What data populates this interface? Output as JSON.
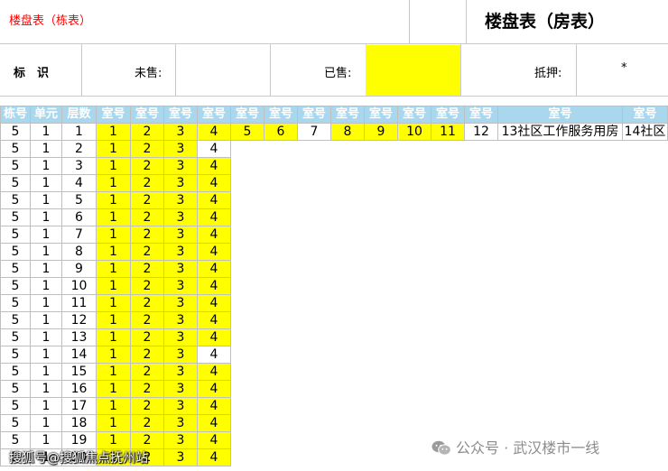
{
  "sheet_title": "楼盘表（栋表）",
  "main_title": "楼盘表（房表）",
  "legend": {
    "mark_label": "标　识",
    "unsold_label": "未售:",
    "sold_label": "已售:",
    "mortgaged_label": "抵押:",
    "mortgaged_value": "*",
    "sold_color": "#ffff00",
    "unsold_color": "#ffffff"
  },
  "table": {
    "headers": [
      "栋号",
      "单元",
      "层数",
      "室号",
      "室号",
      "室号",
      "室号",
      "室号",
      "室号",
      "室号",
      "室号",
      "室号",
      "室号",
      "室号",
      "室号",
      "室号",
      "室号"
    ],
    "header_color": "#a8d7ee",
    "first_row": {
      "building": "5",
      "unit": "1",
      "floor": "1",
      "rooms": [
        {
          "no": "1",
          "sold": true
        },
        {
          "no": "2",
          "sold": true
        },
        {
          "no": "3",
          "sold": true
        },
        {
          "no": "4",
          "sold": true
        },
        {
          "no": "5",
          "sold": true
        },
        {
          "no": "6",
          "sold": true
        },
        {
          "no": "7",
          "sold": false
        },
        {
          "no": "8",
          "sold": true
        },
        {
          "no": "9",
          "sold": true
        },
        {
          "no": "10",
          "sold": true
        },
        {
          "no": "11",
          "sold": true
        },
        {
          "no": "12",
          "sold": false
        },
        {
          "no": "13社区工作服务用房",
          "sold": false
        },
        {
          "no": "14社区",
          "sold": false
        }
      ]
    },
    "rows": [
      {
        "building": "5",
        "unit": "1",
        "floor": "2",
        "rooms": [
          {
            "no": "1",
            "sold": true
          },
          {
            "no": "2",
            "sold": true
          },
          {
            "no": "3",
            "sold": true
          },
          {
            "no": "4",
            "sold": false
          }
        ]
      },
      {
        "building": "5",
        "unit": "1",
        "floor": "3",
        "rooms": [
          {
            "no": "1",
            "sold": true
          },
          {
            "no": "2",
            "sold": true
          },
          {
            "no": "3",
            "sold": true
          },
          {
            "no": "4",
            "sold": true
          }
        ]
      },
      {
        "building": "5",
        "unit": "1",
        "floor": "4",
        "rooms": [
          {
            "no": "1",
            "sold": true
          },
          {
            "no": "2",
            "sold": true
          },
          {
            "no": "3",
            "sold": true
          },
          {
            "no": "4",
            "sold": true
          }
        ]
      },
      {
        "building": "5",
        "unit": "1",
        "floor": "5",
        "rooms": [
          {
            "no": "1",
            "sold": true
          },
          {
            "no": "2",
            "sold": true
          },
          {
            "no": "3",
            "sold": true
          },
          {
            "no": "4",
            "sold": true
          }
        ]
      },
      {
        "building": "5",
        "unit": "1",
        "floor": "6",
        "rooms": [
          {
            "no": "1",
            "sold": true
          },
          {
            "no": "2",
            "sold": true
          },
          {
            "no": "3",
            "sold": true
          },
          {
            "no": "4",
            "sold": true
          }
        ]
      },
      {
        "building": "5",
        "unit": "1",
        "floor": "7",
        "rooms": [
          {
            "no": "1",
            "sold": true
          },
          {
            "no": "2",
            "sold": true
          },
          {
            "no": "3",
            "sold": true
          },
          {
            "no": "4",
            "sold": true
          }
        ]
      },
      {
        "building": "5",
        "unit": "1",
        "floor": "8",
        "rooms": [
          {
            "no": "1",
            "sold": true
          },
          {
            "no": "2",
            "sold": true
          },
          {
            "no": "3",
            "sold": true
          },
          {
            "no": "4",
            "sold": true
          }
        ]
      },
      {
        "building": "5",
        "unit": "1",
        "floor": "9",
        "rooms": [
          {
            "no": "1",
            "sold": true
          },
          {
            "no": "2",
            "sold": true
          },
          {
            "no": "3",
            "sold": true
          },
          {
            "no": "4",
            "sold": true
          }
        ]
      },
      {
        "building": "5",
        "unit": "1",
        "floor": "10",
        "rooms": [
          {
            "no": "1",
            "sold": true
          },
          {
            "no": "2",
            "sold": true
          },
          {
            "no": "3",
            "sold": true
          },
          {
            "no": "4",
            "sold": true
          }
        ]
      },
      {
        "building": "5",
        "unit": "1",
        "floor": "11",
        "rooms": [
          {
            "no": "1",
            "sold": true
          },
          {
            "no": "2",
            "sold": true
          },
          {
            "no": "3",
            "sold": true
          },
          {
            "no": "4",
            "sold": true
          }
        ]
      },
      {
        "building": "5",
        "unit": "1",
        "floor": "12",
        "rooms": [
          {
            "no": "1",
            "sold": true
          },
          {
            "no": "2",
            "sold": true
          },
          {
            "no": "3",
            "sold": true
          },
          {
            "no": "4",
            "sold": true
          }
        ]
      },
      {
        "building": "5",
        "unit": "1",
        "floor": "13",
        "rooms": [
          {
            "no": "1",
            "sold": true
          },
          {
            "no": "2",
            "sold": true
          },
          {
            "no": "3",
            "sold": true
          },
          {
            "no": "4",
            "sold": true
          }
        ]
      },
      {
        "building": "5",
        "unit": "1",
        "floor": "14",
        "rooms": [
          {
            "no": "1",
            "sold": true
          },
          {
            "no": "2",
            "sold": true
          },
          {
            "no": "3",
            "sold": true
          },
          {
            "no": "4",
            "sold": false
          }
        ]
      },
      {
        "building": "5",
        "unit": "1",
        "floor": "15",
        "rooms": [
          {
            "no": "1",
            "sold": true
          },
          {
            "no": "2",
            "sold": true
          },
          {
            "no": "3",
            "sold": true
          },
          {
            "no": "4",
            "sold": true
          }
        ]
      },
      {
        "building": "5",
        "unit": "1",
        "floor": "16",
        "rooms": [
          {
            "no": "1",
            "sold": true
          },
          {
            "no": "2",
            "sold": true
          },
          {
            "no": "3",
            "sold": true
          },
          {
            "no": "4",
            "sold": true
          }
        ]
      },
      {
        "building": "5",
        "unit": "1",
        "floor": "17",
        "rooms": [
          {
            "no": "1",
            "sold": true
          },
          {
            "no": "2",
            "sold": true
          },
          {
            "no": "3",
            "sold": true
          },
          {
            "no": "4",
            "sold": true
          }
        ]
      },
      {
        "building": "5",
        "unit": "1",
        "floor": "18",
        "rooms": [
          {
            "no": "1",
            "sold": true
          },
          {
            "no": "2",
            "sold": true
          },
          {
            "no": "3",
            "sold": true
          },
          {
            "no": "4",
            "sold": true
          }
        ]
      },
      {
        "building": "5",
        "unit": "1",
        "floor": "19",
        "rooms": [
          {
            "no": "1",
            "sold": true
          },
          {
            "no": "2",
            "sold": true
          },
          {
            "no": "3",
            "sold": true
          },
          {
            "no": "4",
            "sold": true
          }
        ]
      },
      {
        "building": "5",
        "unit": "1",
        "floor": "20",
        "rooms": [
          {
            "no": "1",
            "sold": true
          },
          {
            "no": "2",
            "sold": true
          },
          {
            "no": "3",
            "sold": true
          },
          {
            "no": "4",
            "sold": true
          }
        ]
      }
    ]
  },
  "watermarks": {
    "left": "搜狐号@搜狐焦点抚州站",
    "right": "公众号 · 武汉楼市一线",
    "right_icon": "wechat-icon"
  }
}
